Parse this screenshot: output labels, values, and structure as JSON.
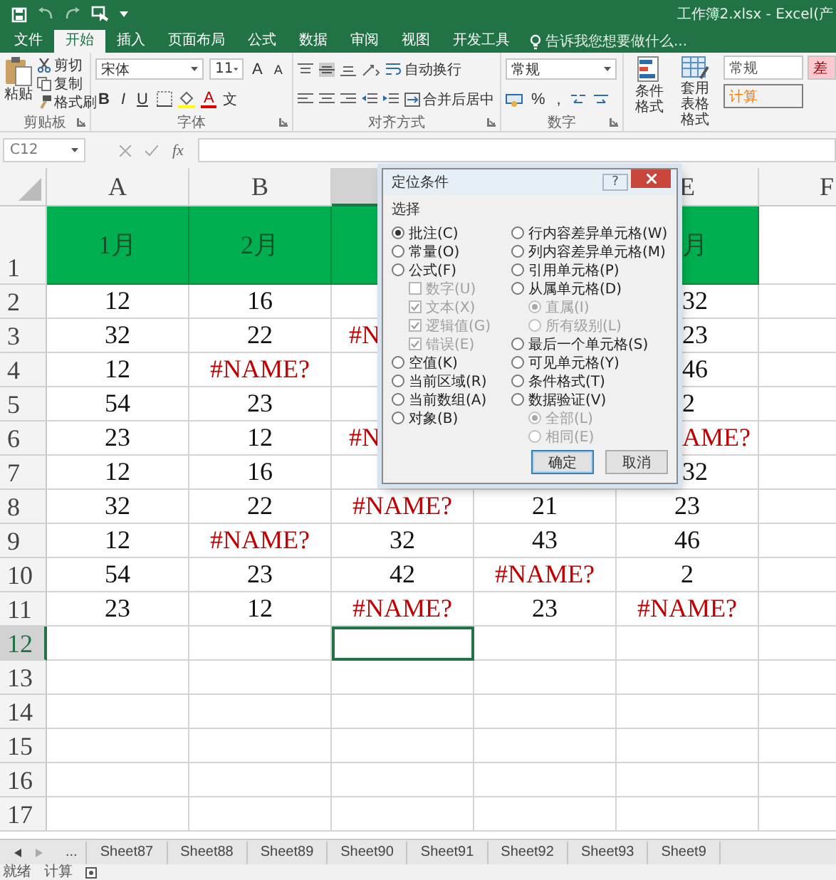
{
  "window": {
    "title": "工作簿2.xlsx - Excel(产"
  },
  "ribbon_tabs": [
    {
      "label": "文件",
      "selected": false
    },
    {
      "label": "开始",
      "selected": true
    },
    {
      "label": "插入",
      "selected": false
    },
    {
      "label": "页面布局",
      "selected": false
    },
    {
      "label": "公式",
      "selected": false
    },
    {
      "label": "数据",
      "selected": false
    },
    {
      "label": "审阅",
      "selected": false
    },
    {
      "label": "视图",
      "selected": false
    },
    {
      "label": "开发工具",
      "selected": false
    }
  ],
  "tell_me": {
    "placeholder": "告诉我您想要做什么..."
  },
  "clipboard": {
    "paste": "粘贴",
    "cut": "剪切",
    "copy": "复制",
    "format_painter": "格式刷",
    "label": "剪贴板"
  },
  "font": {
    "name": "宋体",
    "size": "11",
    "grow": "A",
    "shrink": "A",
    "bold": "B",
    "italic": "I",
    "underline": "U",
    "color_letter": "A",
    "phonetic": "文",
    "label": "字体"
  },
  "alignment": {
    "wrap": "自动换行",
    "merge": "合并后居中",
    "label": "对齐方式"
  },
  "number": {
    "format": "常规",
    "percent": "%",
    "comma": ",",
    "label": "数字"
  },
  "styles": {
    "conditional": "条件格式",
    "table_1": "套用",
    "table_2": "表格格式",
    "cells": [
      {
        "text": "常规",
        "kind": "normal"
      },
      {
        "text": "计算",
        "kind": "calc"
      },
      {
        "text": "差",
        "kind": "bad"
      }
    ]
  },
  "formula_bar": {
    "name_box": "C12",
    "function": "fx"
  },
  "sheet": {
    "columns": [
      {
        "label": "A",
        "selected": false
      },
      {
        "label": "B",
        "selected": false
      },
      {
        "selected": true
      },
      null,
      {
        "label": "E",
        "selected": false
      },
      {
        "label": "F",
        "selected": false
      }
    ],
    "rows": [
      {
        "label": "1",
        "selected": false,
        "cells": [
          {
            "text": "1月",
            "kind": "header"
          },
          {
            "text": "2月",
            "kind": "header"
          },
          {
            "kind": "header"
          },
          null,
          {
            "text": "月",
            "kind": "header",
            "covered": true
          }
        ]
      },
      {
        "label": "2",
        "selected": false,
        "cells": [
          {
            "text": "12",
            "kind": "number"
          },
          {
            "text": "16",
            "kind": "number"
          },
          null,
          null,
          {
            "text": "32",
            "kind": "number",
            "covered": true
          }
        ]
      },
      {
        "label": "3",
        "selected": false,
        "cells": [
          {
            "text": "32",
            "kind": "number"
          },
          {
            "text": "22",
            "kind": "number"
          },
          {
            "text": "#N",
            "kind": "error",
            "covered": true
          },
          null,
          {
            "text": "23",
            "kind": "number",
            "covered": true
          }
        ]
      },
      {
        "label": "4",
        "selected": false,
        "cells": [
          {
            "text": "12",
            "kind": "number"
          },
          {
            "text": "#NAME?",
            "kind": "error"
          },
          null,
          null,
          {
            "text": "46",
            "kind": "number",
            "covered": true
          }
        ]
      },
      {
        "label": "5",
        "selected": false,
        "cells": [
          {
            "text": "54",
            "kind": "number"
          },
          {
            "text": "23",
            "kind": "number"
          },
          null,
          null,
          {
            "text": "2",
            "kind": "number",
            "covered": true
          }
        ]
      },
      {
        "label": "6",
        "selected": false,
        "cells": [
          {
            "text": "23",
            "kind": "number"
          },
          {
            "text": "12",
            "kind": "number"
          },
          {
            "text": "#N",
            "kind": "error",
            "covered": true
          },
          null,
          {
            "text": "AME?",
            "kind": "error",
            "covered": true
          }
        ]
      },
      {
        "label": "7",
        "selected": false,
        "cells": [
          {
            "text": "12",
            "kind": "number"
          },
          {
            "text": "16",
            "kind": "number"
          },
          null,
          null,
          {
            "text": "32",
            "kind": "number",
            "covered": true
          }
        ]
      },
      {
        "label": "8",
        "selected": false,
        "cells": [
          {
            "text": "32",
            "kind": "number"
          },
          {
            "text": "22",
            "kind": "number"
          },
          {
            "text": "#NAME?",
            "kind": "error"
          },
          {
            "text": "21",
            "kind": "number"
          },
          {
            "text": "23",
            "kind": "number"
          }
        ]
      },
      {
        "label": "9",
        "selected": false,
        "cells": [
          {
            "text": "12",
            "kind": "number"
          },
          {
            "text": "#NAME?",
            "kind": "error"
          },
          {
            "text": "32",
            "kind": "number"
          },
          {
            "text": "43",
            "kind": "number"
          },
          {
            "text": "46",
            "kind": "number"
          }
        ]
      },
      {
        "label": "10",
        "selected": false,
        "cells": [
          {
            "text": "54",
            "kind": "number"
          },
          {
            "text": "23",
            "kind": "number"
          },
          {
            "text": "42",
            "kind": "number"
          },
          {
            "text": "#NAME?",
            "kind": "error"
          },
          {
            "text": "2",
            "kind": "number"
          }
        ]
      },
      {
        "label": "11",
        "selected": false,
        "cells": [
          {
            "text": "23",
            "kind": "number"
          },
          {
            "text": "12",
            "kind": "number"
          },
          {
            "text": "#NAME?",
            "kind": "error"
          },
          {
            "text": "23",
            "kind": "number"
          },
          {
            "text": "#NAME?",
            "kind": "error"
          }
        ]
      },
      {
        "label": "12",
        "selected": true
      },
      {
        "label": "13",
        "selected": false
      },
      {
        "label": "14",
        "selected": false
      },
      {
        "label": "15",
        "selected": false
      },
      {
        "label": "16",
        "selected": false
      },
      {
        "label": "17",
        "selected": false
      }
    ]
  },
  "dialog": {
    "title": "定位条件",
    "help": "?",
    "group_label": "选择",
    "left_options": [
      {
        "label": "批注(C)",
        "kind": "radio",
        "selected": true,
        "disabled": false
      },
      {
        "label": "常量(O)",
        "kind": "radio",
        "selected": false,
        "disabled": false
      },
      {
        "label": "公式(F)",
        "kind": "radio",
        "selected": false,
        "disabled": false
      },
      {
        "label": "数字(U)",
        "kind": "check",
        "checked": false,
        "disabled": true
      },
      {
        "label": "文本(X)",
        "kind": "check",
        "checked": true,
        "disabled": true
      },
      {
        "label": "逻辑值(G)",
        "kind": "check",
        "checked": true,
        "disabled": true
      },
      {
        "label": "错误(E)",
        "kind": "check",
        "checked": true,
        "disabled": true
      },
      {
        "label": "空值(K)",
        "kind": "radio",
        "selected": false,
        "disabled": false
      },
      {
        "label": "当前区域(R)",
        "kind": "radio",
        "selected": false,
        "disabled": false
      },
      {
        "label": "当前数组(A)",
        "kind": "radio",
        "selected": false,
        "disabled": false
      },
      {
        "label": "对象(B)",
        "kind": "radio",
        "selected": false,
        "disabled": false
      }
    ],
    "right_options": [
      {
        "label": "行内容差异单元格(W)",
        "kind": "radio",
        "selected": false,
        "disabled": false
      },
      {
        "label": "列内容差异单元格(M)",
        "kind": "radio",
        "selected": false,
        "disabled": false
      },
      {
        "label": "引用单元格(P)",
        "kind": "radio",
        "selected": false,
        "disabled": false
      },
      {
        "label": "从属单元格(D)",
        "kind": "radio",
        "selected": false,
        "disabled": false
      },
      {
        "label": "直属(I)",
        "kind": "subradio",
        "selected": true,
        "disabled": true
      },
      {
        "label": "所有级别(L)",
        "kind": "subradio",
        "selected": false,
        "disabled": true
      },
      {
        "label": "最后一个单元格(S)",
        "kind": "radio",
        "selected": false,
        "disabled": false
      },
      {
        "label": "可见单元格(Y)",
        "kind": "radio",
        "selected": false,
        "disabled": false
      },
      {
        "label": "条件格式(T)",
        "kind": "radio",
        "selected": false,
        "disabled": false
      },
      {
        "label": "数据验证(V)",
        "kind": "radio",
        "selected": false,
        "disabled": false
      },
      {
        "label": "全部(L)",
        "kind": "subradio",
        "selected": true,
        "disabled": true
      },
      {
        "label": "相同(E)",
        "kind": "subradio",
        "selected": false,
        "disabled": true
      }
    ],
    "buttons": [
      {
        "label": "确定",
        "default": true
      },
      {
        "label": "取消",
        "default": false
      }
    ]
  },
  "sheet_tabs": {
    "overflow": "...",
    "tabs": [
      "Sheet87",
      "Sheet88",
      "Sheet89",
      "Sheet90",
      "Sheet91",
      "Sheet92",
      "Sheet93",
      "Sheet9"
    ]
  },
  "status_bar": {
    "items": [
      "就绪",
      "计算"
    ]
  }
}
